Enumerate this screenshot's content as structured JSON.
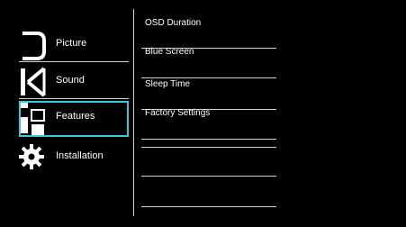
{
  "menu": {
    "items": [
      {
        "label": "Picture",
        "icon": "picture-icon"
      },
      {
        "label": "Sound",
        "icon": "sound-icon"
      },
      {
        "label": "Features",
        "icon": "features-icon",
        "selected": true
      },
      {
        "label": "Installation",
        "icon": "installation-icon"
      }
    ]
  },
  "submenu": {
    "items": [
      {
        "label": "OSD Duration"
      },
      {
        "label": "Blue Screen"
      },
      {
        "label": "Sleep Time"
      },
      {
        "label": "Factory Settings"
      },
      {
        "label": ""
      },
      {
        "label": ""
      },
      {
        "label": ""
      }
    ]
  },
  "colors": {
    "background": "#000000",
    "highlight": "#37c9d8",
    "text": "#ffffff",
    "divider": "#cfcfcf"
  }
}
